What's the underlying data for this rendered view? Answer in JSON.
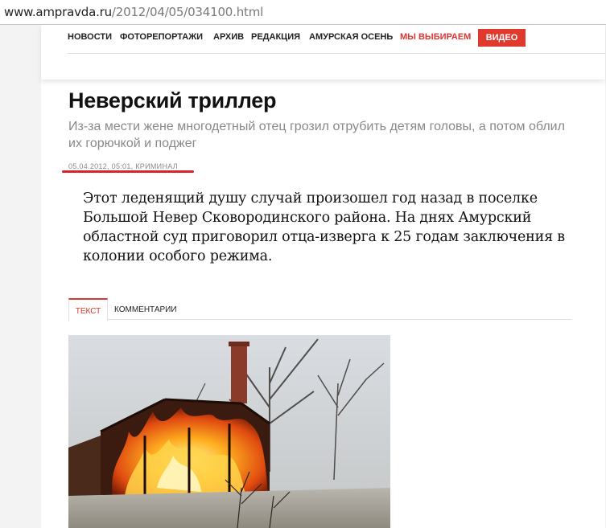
{
  "browser": {
    "url_domain": "www.ampravda.ru",
    "url_path": "/2012/04/05/034100.html"
  },
  "nav": {
    "items": [
      "НОВОСТИ",
      "ФОТОРЕПОРТАЖИ",
      "АРХИВ",
      "РЕДАКЦИЯ",
      "АМУРСКАЯ ОСЕНЬ"
    ],
    "highlight": "МЫ ВЫБИРАЕМ",
    "video": "ВИДЕО"
  },
  "article": {
    "title": "Неверский триллер",
    "subtitle": "Из-за мести жене многодетный отец грозил отрубить детям головы, а потом облил их горючкой и поджег",
    "meta": "05.04.2012, 05:01, КРИМИНАЛ",
    "lead": "Этот леденящий душу случай произошел год назад в поселке Большой Невер Сковородинского района. На днях Амурский областной суд приговорил отца-изверга к 25 годам заключения в колонии особого режима."
  },
  "tabs": {
    "text": "ТЕКСТ",
    "comments": "КОММЕНТАРИИ"
  },
  "colors": {
    "accent": "#d9372f",
    "underline_annotation": "#d8232a"
  }
}
